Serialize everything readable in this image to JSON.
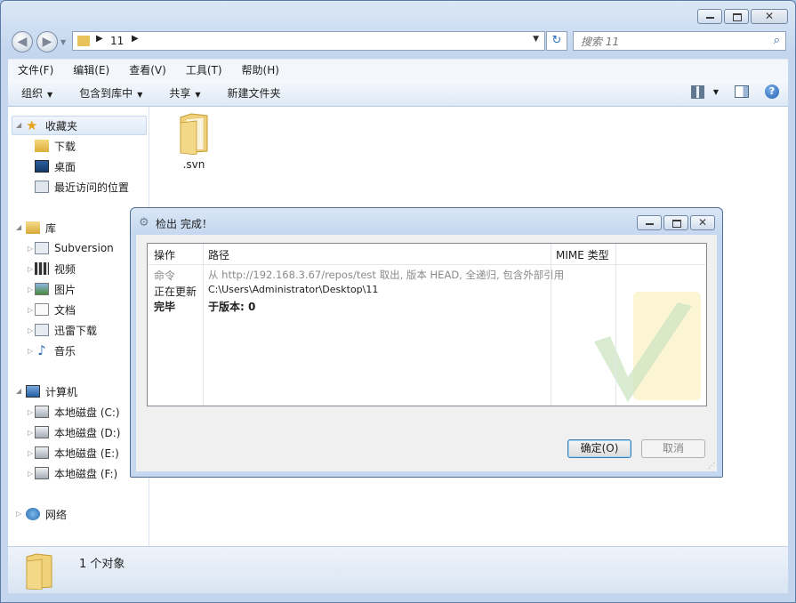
{
  "explorer": {
    "address": {
      "crumb": "11"
    },
    "search": {
      "placeholder": "搜索 11"
    },
    "menu": [
      "文件(F)",
      "编辑(E)",
      "查看(V)",
      "工具(T)",
      "帮助(H)"
    ],
    "toolbar": {
      "organize": "组织",
      "include": "包含到库中",
      "share": "共享",
      "new_folder": "新建文件夹"
    },
    "nav": {
      "favorites": "收藏夹",
      "downloads": "下载",
      "desktop": "桌面",
      "recent": "最近访问的位置",
      "libraries": "库",
      "subversion": "Subversion",
      "videos": "视频",
      "pictures": "图片",
      "documents": "文档",
      "thunder": "迅雷下载",
      "music": "音乐",
      "computer": "计算机",
      "disk_c": "本地磁盘 (C:)",
      "disk_d": "本地磁盘 (D:)",
      "disk_e": "本地磁盘 (E:)",
      "disk_f": "本地磁盘 (F:)",
      "network": "网络"
    },
    "files": [
      {
        "name": ".svn"
      }
    ],
    "details": {
      "count_text": "1 个对象"
    }
  },
  "dialog": {
    "title": "检出 完成！",
    "columns": {
      "action": "操作",
      "path": "路径",
      "mime": "MIME 类型"
    },
    "rows": [
      {
        "action": "命令",
        "path": "从 http://192.168.3.67/repos/test 取出, 版本 HEAD, 全递归, 包含外部引用"
      },
      {
        "action": "正在更新",
        "path": "C:\\Users\\Administrator\\Desktop\\11"
      },
      {
        "action": "完毕",
        "path": "于版本: 0"
      }
    ],
    "ok_label": "确定(O)",
    "cancel_label": "取消"
  },
  "colors": {
    "accent": "#3c7fb1",
    "folder": "#e8c35a",
    "window_frame": "#c3d6ee"
  }
}
